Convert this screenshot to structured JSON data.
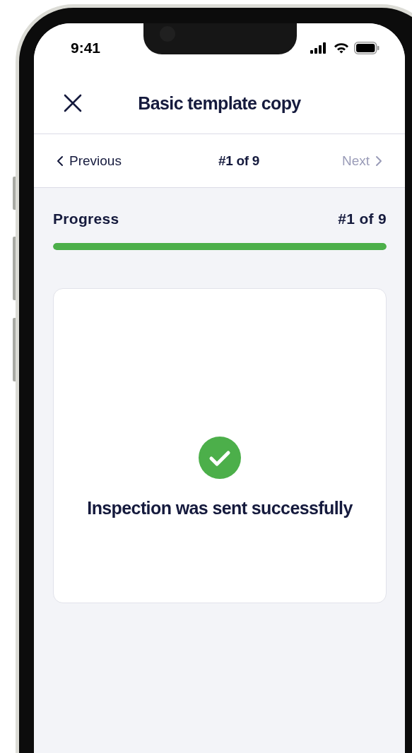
{
  "status_bar": {
    "time": "9:41"
  },
  "header": {
    "title": "Basic template copy"
  },
  "navigation": {
    "previous": {
      "label": "Previous",
      "disabled": false
    },
    "position": "#1 of 9",
    "next": {
      "label": "Next",
      "disabled": true
    }
  },
  "progress": {
    "label": "Progress",
    "count": "#1 of 9",
    "level": 1
  },
  "message": {
    "text": "Inspection was sent successfully"
  }
}
